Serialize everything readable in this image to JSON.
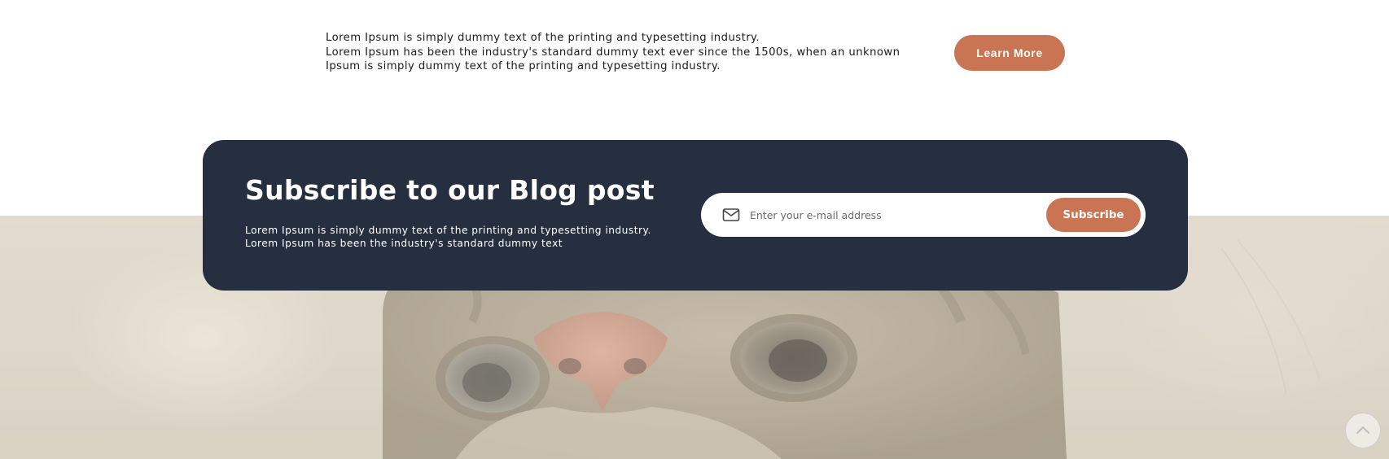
{
  "info": {
    "lines": [
      "Lorem Ipsum is simply dummy text of the printing and typesetting industry.",
      "Lorem Ipsum has been the industry's standard dummy text ever since the 1500s, when an unknown",
      "Ipsum is simply dummy text of the printing and typesetting industry."
    ],
    "button_label": "Learn More"
  },
  "subscribe": {
    "title": "Subscribe to our Blog post",
    "description": [
      "Lorem Ipsum is simply dummy text of the printing and typesetting industry.",
      "Lorem Ipsum has been the industry's standard dummy text"
    ],
    "email_placeholder": "Enter your e-mail address",
    "email_value": "",
    "button_label": "Subscribe",
    "icon": "mail-icon"
  },
  "scroll_top": {
    "icon": "chevron-up-icon"
  },
  "hero": {
    "image": "cat-photo"
  },
  "colors": {
    "accent": "#c97452",
    "card_bg": "#252f3f",
    "text": "#1b1b1b",
    "white": "#ffffff"
  }
}
